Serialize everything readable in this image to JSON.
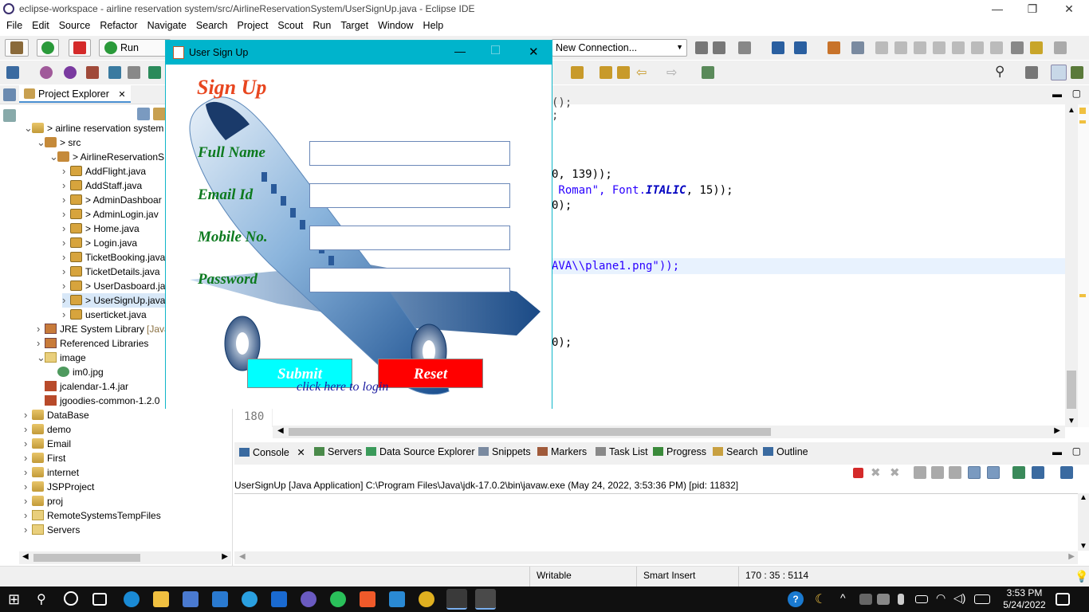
{
  "window": {
    "title": "eclipse-workspace - airline reservation system/src/AirlineReservationSystem/UserSignUp.java - Eclipse IDE",
    "minimize": "—",
    "restore": "❐",
    "close": "✕"
  },
  "menu": [
    "File",
    "Edit",
    "Source",
    "Refactor",
    "Navigate",
    "Search",
    "Project",
    "Scout",
    "Run",
    "Target",
    "Window",
    "Help"
  ],
  "toolbar": {
    "run_label": "Run",
    "connection_label": "New Connection..."
  },
  "project_explorer": {
    "tab_label": "Project Explorer",
    "tree": [
      {
        "label": "> airline reservation system",
        "indent": 0,
        "icon": "project",
        "twisty": "open"
      },
      {
        "label": "> src",
        "indent": 1,
        "icon": "package-folder",
        "twisty": "open"
      },
      {
        "label": "> AirlineReservationS",
        "indent": 2,
        "icon": "package",
        "twisty": "open"
      },
      {
        "label": "AddFlight.java",
        "indent": 3,
        "icon": "java-file",
        "twisty": "closed"
      },
      {
        "label": "AddStaff.java",
        "indent": 3,
        "icon": "java-file",
        "twisty": "closed"
      },
      {
        "label": "> AdminDashboar",
        "indent": 3,
        "icon": "java-file",
        "twisty": "closed"
      },
      {
        "label": "> AdminLogin.jav",
        "indent": 3,
        "icon": "java-file",
        "twisty": "closed"
      },
      {
        "label": "> Home.java",
        "indent": 3,
        "icon": "java-file",
        "twisty": "closed"
      },
      {
        "label": "> Login.java",
        "indent": 3,
        "icon": "java-file",
        "twisty": "closed"
      },
      {
        "label": "TicketBooking.java",
        "indent": 3,
        "icon": "java-file",
        "twisty": "closed"
      },
      {
        "label": "TicketDetails.java",
        "indent": 3,
        "icon": "java-file",
        "twisty": "closed"
      },
      {
        "label": "> UserDasboard.ja",
        "indent": 3,
        "icon": "java-file",
        "twisty": "closed"
      },
      {
        "label": "> UserSignUp.java",
        "indent": 3,
        "icon": "java-file",
        "twisty": "closed",
        "selected": true
      },
      {
        "label": "userticket.java",
        "indent": 3,
        "icon": "java-file",
        "twisty": "closed"
      },
      {
        "label": "JRE System Library",
        "suffix": "[Java",
        "indent": 1,
        "icon": "library",
        "twisty": "closed"
      },
      {
        "label": "Referenced Libraries",
        "indent": 1,
        "icon": "library",
        "twisty": "closed"
      },
      {
        "label": "image",
        "indent": 1,
        "icon": "folder",
        "twisty": "open"
      },
      {
        "label": "im0.jpg",
        "indent": 2,
        "icon": "image-file",
        "twisty": "none"
      },
      {
        "label": "jcalendar-1.4.jar",
        "indent": 1,
        "icon": "jar-file",
        "twisty": "none"
      },
      {
        "label": "jgoodies-common-1.2.0",
        "indent": 1,
        "icon": "jar-file",
        "twisty": "none"
      },
      {
        "label": "DataBase",
        "indent": 0,
        "icon": "project",
        "twisty": "closed"
      },
      {
        "label": "demo",
        "indent": 0,
        "icon": "project",
        "twisty": "closed"
      },
      {
        "label": "Email",
        "indent": 0,
        "icon": "project",
        "twisty": "closed"
      },
      {
        "label": "First",
        "indent": 0,
        "icon": "project",
        "twisty": "closed"
      },
      {
        "label": "internet",
        "indent": 0,
        "icon": "project",
        "twisty": "closed"
      },
      {
        "label": "JSPProject",
        "indent": 0,
        "icon": "project",
        "twisty": "closed"
      },
      {
        "label": "proj",
        "indent": 0,
        "icon": "project",
        "twisty": "closed"
      },
      {
        "label": "RemoteSystemsTempFiles",
        "indent": 0,
        "icon": "folder",
        "twisty": "closed"
      },
      {
        "label": "Servers",
        "indent": 0,
        "icon": "folder",
        "twisty": "closed"
      }
    ]
  },
  "editor": {
    "code_lines": [
      {
        "pre": "0, 139));",
        "kw": "",
        "post": ""
      },
      {
        "pre": " Roman\", Font.",
        "kw": "ITALIC",
        "post": ", 15));"
      },
      {
        "pre": "0);",
        "kw": "",
        "post": ""
      },
      {
        "pre": "AVA\\\\plane1.png\"));",
        "kw": "",
        "post": ""
      },
      {
        "pre": "0);",
        "kw": "",
        "post": ""
      }
    ],
    "line_number": "180",
    "truncated_top": "();",
    "truncated_top2": ";"
  },
  "console": {
    "tabs": [
      "Console",
      "Servers",
      "Data Source Explorer",
      "Snippets",
      "Markers",
      "Task List",
      "Progress",
      "Search",
      "Outline"
    ],
    "header": "UserSignUp [Java Application] C:\\Program Files\\Java\\jdk-17.0.2\\bin\\javaw.exe  (May 24, 2022, 3:53:36 PM) [pid: 11832]"
  },
  "statusbar": {
    "writable": "Writable",
    "insert_mode": "Smart Insert",
    "position": "170 : 35 : 5114"
  },
  "taskbar": {
    "time": "3:53 PM",
    "date": "5/24/2022"
  },
  "dialog": {
    "title": "User Sign Up",
    "heading": "Sign Up",
    "fields": [
      {
        "label": "Full Name",
        "value": ""
      },
      {
        "label": "Email Id",
        "value": ""
      },
      {
        "label": "Mobile No.",
        "value": ""
      },
      {
        "label": "Password",
        "value": ""
      }
    ],
    "submit_label": "Submit",
    "reset_label": "Reset",
    "login_link": "click here to login",
    "colors": {
      "submit_bg": "#00ffff",
      "reset_bg": "#ff0000",
      "title_bar": "#00b4cc",
      "heading": "#e8461f",
      "labels": "#0d7a1f"
    }
  }
}
